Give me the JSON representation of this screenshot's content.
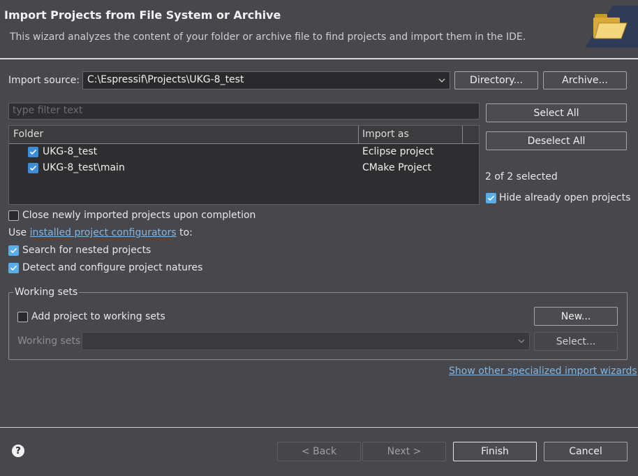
{
  "header": {
    "title": "Import Projects from File System or Archive",
    "description": "This wizard analyzes the content of your folder or archive file to find projects and import them in the IDE.",
    "icon": "open-folder-icon"
  },
  "import_source": {
    "label": "Import source:",
    "value": "C:\\Espressif\\Projects\\UKG-8_test",
    "directory_button": "Directory...",
    "archive_button": "Archive..."
  },
  "filter": {
    "placeholder": "type filter text"
  },
  "table": {
    "columns": [
      "Folder",
      "Import as"
    ],
    "rows": [
      {
        "folder": "UKG-8_test",
        "import_as": "Eclipse project",
        "checked": true
      },
      {
        "folder": "UKG-8_test\\main",
        "import_as": "CMake Project",
        "checked": true
      }
    ]
  },
  "side": {
    "select_all": "Select All",
    "deselect_all": "Deselect All",
    "selected_count": "2 of 2 selected",
    "hide_open": "Hide already open projects"
  },
  "options": {
    "close_imported": "Close newly imported projects upon completion",
    "use_prefix": "Use ",
    "configurators_link": "installed project configurators",
    "use_suffix": " to:",
    "search_nested": "Search for nested projects",
    "detect_configure": "Detect and configure project natures"
  },
  "working_sets": {
    "title": "Working sets",
    "add_label": "Add project to working sets",
    "new_button": "New...",
    "sets_label": "Working sets:",
    "select_button": "Select..."
  },
  "show_other_link": "Show other specialized import wizards",
  "footer": {
    "back": "< Back",
    "next": "Next >",
    "finish": "Finish",
    "cancel": "Cancel"
  },
  "colors": {
    "background": "#48484c",
    "checkbox_accent": "#3d8ed8",
    "link": "#7fb7e6"
  }
}
